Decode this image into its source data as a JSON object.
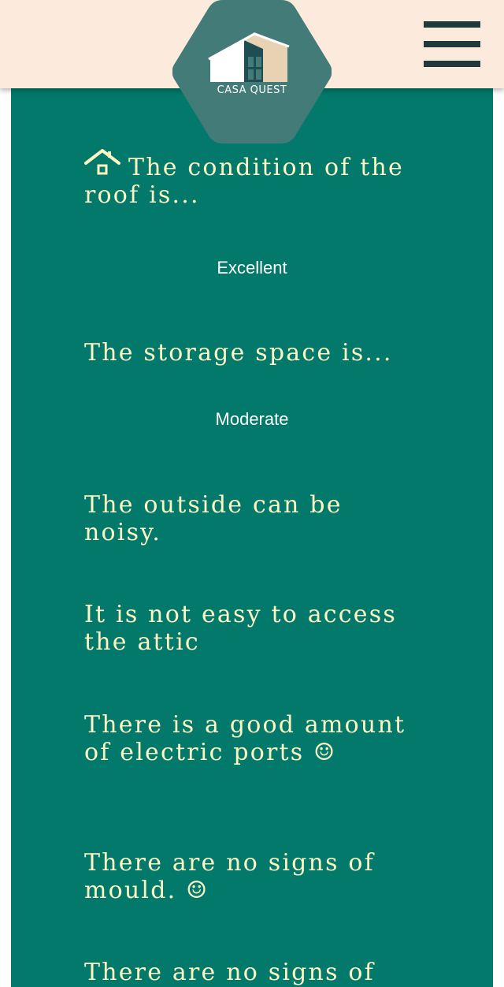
{
  "header": {
    "logo_text": "CASA QUEST",
    "menu_icon": "hamburger-menu-icon"
  },
  "colors": {
    "header_bg": "#fcebdc",
    "panel_bg": "#02796b",
    "logo_hex": "#427b78",
    "text_cream": "#fdf7c3",
    "menu_dark": "#1f3a3d"
  },
  "content": {
    "roof_question": "The condition of the roof is...",
    "roof_answer": "Excellent",
    "storage_question": "The storage space is...",
    "storage_answer": "Moderate",
    "statement_noise": "The outside can be noisy.",
    "statement_attic": "It is not easy to access the attic",
    "statement_ports": "There is a good amount of electric ports ☺",
    "statement_mould": "There are no signs of mould. ☺",
    "statement_partial": "There are no signs of"
  }
}
